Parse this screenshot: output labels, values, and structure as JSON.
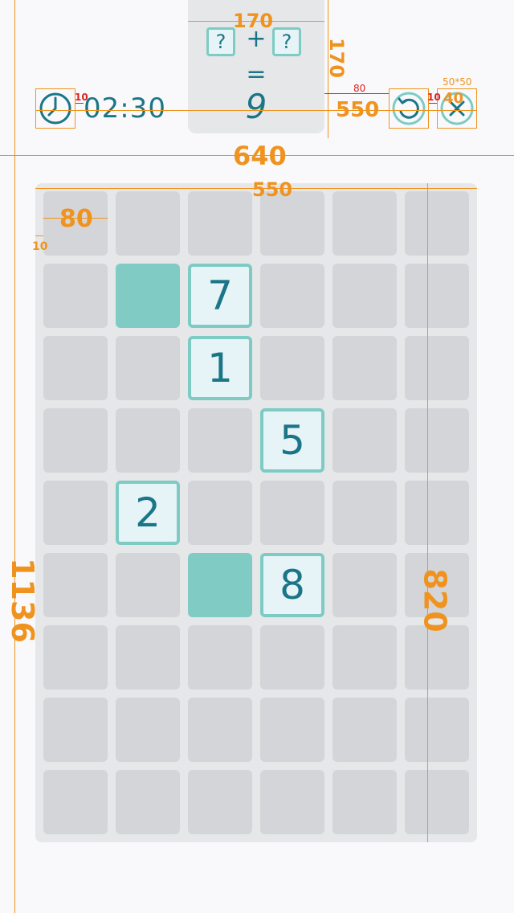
{
  "header": {
    "timer": "02:30",
    "equation": {
      "left_slot": "?",
      "operator": "+",
      "right_slot": "?",
      "equals": "=",
      "target": "9"
    }
  },
  "board": {
    "rows": 9,
    "cols": 6,
    "cells": [
      [
        "",
        "",
        "",
        "",
        "",
        ""
      ],
      [
        "",
        "#",
        "7",
        "",
        "",
        ""
      ],
      [
        "",
        "",
        "1",
        "",
        "",
        ""
      ],
      [
        "",
        "",
        "",
        "5",
        "",
        ""
      ],
      [
        "",
        "2",
        "",
        "",
        "",
        ""
      ],
      [
        "",
        "",
        "#",
        "8",
        "",
        ""
      ],
      [
        "",
        "",
        "",
        "",
        "",
        ""
      ],
      [
        "",
        "",
        "",
        "",
        "",
        ""
      ],
      [
        "",
        "",
        "",
        "",
        "",
        ""
      ]
    ]
  },
  "annotations": {
    "panel_width": "170",
    "panel_height": "170",
    "header_gap_red": "10",
    "button_gap_red": "80",
    "header_span": "550",
    "button_gap_red_2": "10",
    "button_spec": "50*50",
    "button_size": "40",
    "screen_width": "640",
    "board_width": "550",
    "cell_size": "80",
    "cell_gap": "10",
    "screen_height": "1136",
    "board_height": "820"
  },
  "colors": {
    "accent": "#1a7687",
    "tile_border": "#7ecbc4",
    "tile_fill": "#e6f3f7",
    "filled_cell": "#80cbc3",
    "empty_cell": "#d4d5d8",
    "board_bg": "#e6e7e9",
    "guide": "#f0931e",
    "guide_red": "#d9231e"
  },
  "icons": {
    "clock": "clock-icon",
    "reset": "reset-icon",
    "close": "close-icon"
  }
}
